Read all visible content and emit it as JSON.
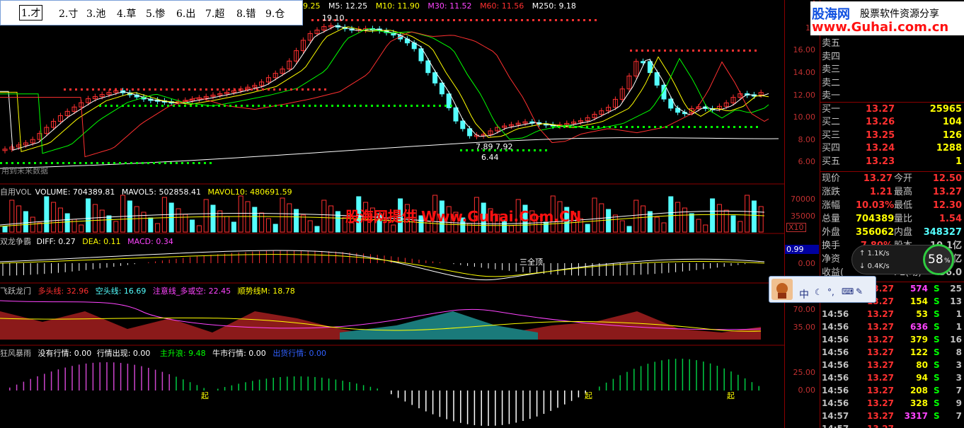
{
  "header": {
    "indicators": [
      {
        "text": "9.25",
        "color": "#ffff00"
      },
      {
        "text": "M5: 12.25",
        "color": "#ffffff"
      },
      {
        "text": "M10: 11.90",
        "color": "#ffff00"
      },
      {
        "text": "M30: 11.52",
        "color": "#ff00ff"
      },
      {
        "text": "M60: 11.56",
        "color": "#ff3030"
      },
      {
        "text": "M250: 9.18",
        "color": "#ffffff"
      }
    ]
  },
  "quick_list": {
    "items": [
      "1.才",
      "2.寸",
      "3.池",
      "4.草",
      "5.惨",
      "6.出",
      "7.超",
      "8.错",
      "9.仓"
    ]
  },
  "price_panel": {
    "ylabels": [
      "18",
      "16.00",
      "14.00",
      "12.00",
      "10.00",
      "8.00",
      "6.00"
    ],
    "high_mark": "19.10",
    "low_mark": "6.44",
    "range_mark": "7.89  7.92",
    "bottom_note": "用到未来数据"
  },
  "volume_panel": {
    "title": "自用VOL",
    "volume": "VOLUME: 704389.81",
    "mavol5": "MAVOL5: 502858.41",
    "mavol10": "MAVOL10: 480691.59",
    "ylabels": [
      "70000",
      "35000"
    ],
    "unit": "X10"
  },
  "macd_panel": {
    "title": "双龙争霸",
    "diff": "DIFF: 0.27",
    "dea": "DEA: 0.11",
    "macd": "MACD: 0.34",
    "ylabels": [
      "0.99",
      "0.00"
    ],
    "mid_label": "三全顶"
  },
  "dragon_panel": {
    "title": "飞跃龙门",
    "long": "多头线: 32.96",
    "short": "空头线: 16.69",
    "attention": "注意线_多或空: 22.45",
    "trend": "顺势线M: 18.78",
    "ylabels": [
      "70.00",
      "35.00"
    ]
  },
  "storm_panel": {
    "title": "狂风暴雨",
    "no_market": "没有行情: 0.00",
    "market": "行情出现: 0.00",
    "main_rise": "主升浪: 9.48",
    "bull": "牛市行情: 0.00",
    "ship": "出货行情: 0.00",
    "ylabels": [
      "25.00",
      "0.00"
    ],
    "markers": [
      "起",
      "起",
      "起"
    ]
  },
  "watermark": "股海网提供 Www.Guhai.Com.CN",
  "logo": {
    "brand": "股海网",
    "slogan": "股票软件资源分享",
    "url": "www.Guhai.com.cn"
  },
  "order_book": {
    "asks": [
      {
        "label": "卖五",
        "price": "",
        "vol": ""
      },
      {
        "label": "卖四",
        "price": "",
        "vol": ""
      },
      {
        "label": "卖三",
        "price": "",
        "vol": ""
      },
      {
        "label": "卖二",
        "price": "",
        "vol": ""
      },
      {
        "label": "卖一",
        "price": "",
        "vol": ""
      }
    ],
    "bids": [
      {
        "label": "买一",
        "price": "13.27",
        "vol": "25965"
      },
      {
        "label": "买二",
        "price": "13.26",
        "vol": "104"
      },
      {
        "label": "买三",
        "price": "13.25",
        "vol": "126"
      },
      {
        "label": "买四",
        "price": "13.24",
        "vol": "1288"
      },
      {
        "label": "买五",
        "price": "13.23",
        "vol": "1"
      }
    ]
  },
  "quote": [
    {
      "l1": "现价",
      "v1": "13.27",
      "l2": "今开",
      "v2": "12.50"
    },
    {
      "l1": "涨跌",
      "v1": "1.21",
      "l2": "最高",
      "v2": "13.27"
    },
    {
      "l1": "涨幅",
      "v1": "10.03%",
      "l2": "最低",
      "v2": "12.30"
    },
    {
      "l1": "总量",
      "v1": "704389",
      "l2": "量比",
      "v2": "1.54"
    },
    {
      "l1": "外盘",
      "v1": "356062",
      "l2": "内盘",
      "v2": "348327"
    },
    {
      "l1": "换手",
      "v1": "7.80%",
      "l2": "股本",
      "v2": "10.1亿"
    },
    {
      "l1": "净资",
      "v1": "",
      "l2": "流通",
      "v2": "8.92亿"
    },
    {
      "l1": "收益(",
      "v1": "",
      "l2": "PE(动)",
      "v2": "36.0"
    }
  ],
  "net_widget": {
    "percent": "58",
    "up": "1.1K/s",
    "down": "0.4K/s"
  },
  "ime_bar": {
    "mode": "中"
  },
  "ticks": [
    {
      "time": "",
      "price": "13.27",
      "vol": "574",
      "dir": "S",
      "n": "25"
    },
    {
      "time": "",
      "price": "13.27",
      "vol": "154",
      "dir": "S",
      "n": "13"
    },
    {
      "time": "14:56",
      "price": "13.27",
      "vol": "53",
      "dir": "S",
      "n": "1"
    },
    {
      "time": "14:56",
      "price": "13.27",
      "vol": "636",
      "dir": "S",
      "n": "1"
    },
    {
      "time": "14:56",
      "price": "13.27",
      "vol": "379",
      "dir": "S",
      "n": "16"
    },
    {
      "time": "14:56",
      "price": "13.27",
      "vol": "122",
      "dir": "S",
      "n": "8"
    },
    {
      "time": "14:56",
      "price": "13.27",
      "vol": "80",
      "dir": "S",
      "n": "3"
    },
    {
      "time": "14:56",
      "price": "13.27",
      "vol": "94",
      "dir": "S",
      "n": "3"
    },
    {
      "time": "14:56",
      "price": "13.27",
      "vol": "208",
      "dir": "S",
      "n": "7"
    },
    {
      "time": "14:56",
      "price": "13.27",
      "vol": "328",
      "dir": "S",
      "n": "9"
    },
    {
      "time": "14:57",
      "price": "13.27",
      "vol": "3317",
      "dir": "S",
      "n": "7"
    },
    {
      "time": "14:57",
      "price": "13.27",
      "vol": "",
      "dir": "",
      "n": ""
    }
  ],
  "colors": {
    "bg": "#000000",
    "grid": "#8b0000",
    "up": "#ff3030",
    "down": "#54ffff",
    "yellow": "#ffff00",
    "green": "#00ff00"
  }
}
